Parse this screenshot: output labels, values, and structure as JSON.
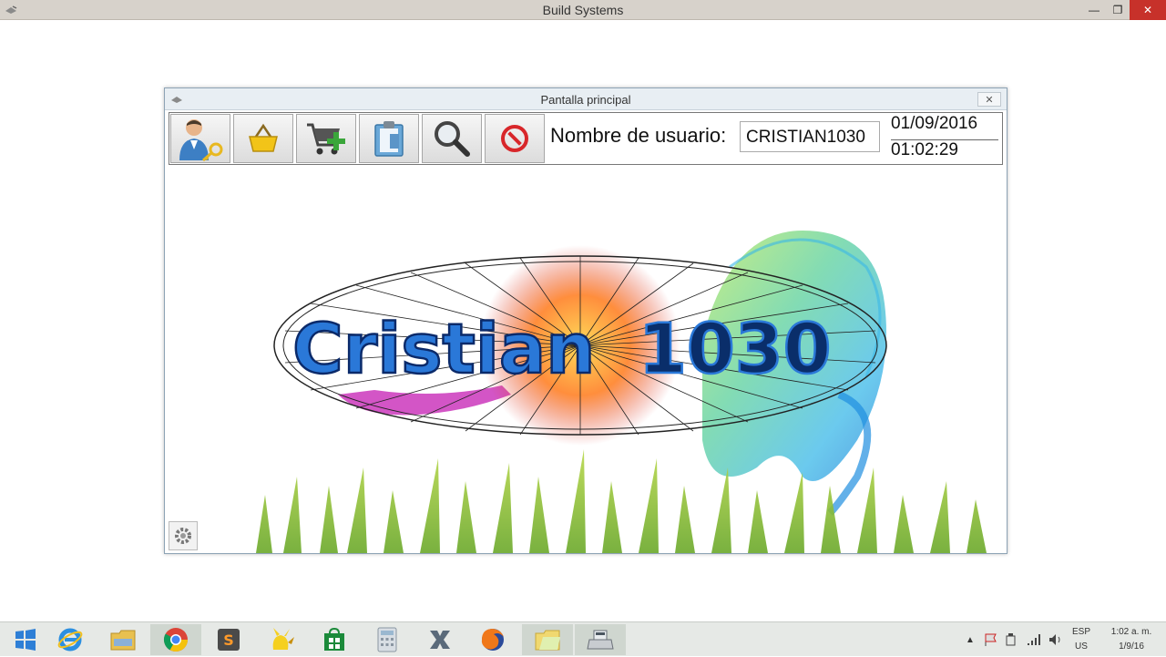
{
  "window": {
    "title": "Build Systems",
    "controls": {
      "minimize": "—",
      "maximize": "❐",
      "close": "✕"
    }
  },
  "dialog": {
    "title": "Pantalla principal",
    "close_label": "✕",
    "toolbar": {
      "buttons": [
        {
          "name": "users",
          "icon": "user-key-icon"
        },
        {
          "name": "products",
          "icon": "basket-icon"
        },
        {
          "name": "add-sale",
          "icon": "cart-add-icon"
        },
        {
          "name": "reports",
          "icon": "clipboard-icon"
        },
        {
          "name": "search",
          "icon": "magnifier-icon"
        },
        {
          "name": "exit",
          "icon": "stop-icon"
        }
      ],
      "user_label": "Nombre de usuario:",
      "user_value": "CRISTIAN1030",
      "date": "01/09/2016",
      "time": "01:02:29"
    },
    "logo_text": {
      "part1": "Cristian",
      "part2": "1030"
    },
    "settings_icon": "gear-icon"
  },
  "taskbar": {
    "items": [
      {
        "name": "start",
        "icon": "windows-icon"
      },
      {
        "name": "internet-explorer",
        "icon": "ie-icon"
      },
      {
        "name": "file-explorer",
        "icon": "folder-icon"
      },
      {
        "name": "chrome",
        "icon": "chrome-icon"
      },
      {
        "name": "sublime-text",
        "icon": "sublime-icon"
      },
      {
        "name": "pikachu-app",
        "icon": "pikachu-icon"
      },
      {
        "name": "store",
        "icon": "store-icon"
      },
      {
        "name": "calculator",
        "icon": "calculator-icon"
      },
      {
        "name": "xampp",
        "icon": "xampp-icon"
      },
      {
        "name": "firefox",
        "icon": "firefox-icon"
      },
      {
        "name": "folder-app",
        "icon": "folder-icon"
      },
      {
        "name": "cash-register",
        "icon": "register-icon"
      }
    ],
    "tray": {
      "language_top": "ESP",
      "language_bottom": "US",
      "clock_time": "1:02 a. m.",
      "clock_date": "1/9/16"
    }
  }
}
